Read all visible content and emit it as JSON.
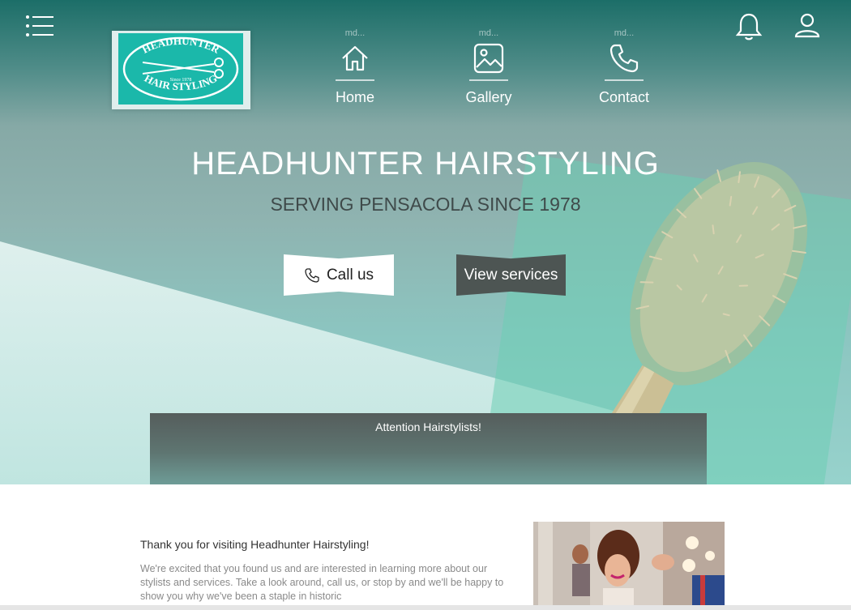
{
  "header": {
    "menu_icon": "list-menu-icon",
    "bell_icon": "bell-icon",
    "user_icon": "user-icon"
  },
  "logo": {
    "top_text": "HEADHUNTER",
    "bottom_text": "HAIR STYLING",
    "since_text": "Since 1978",
    "bg_color": "#1bb8aa"
  },
  "nav": {
    "items": [
      {
        "small": "md...",
        "label": "Home",
        "icon": "home-icon"
      },
      {
        "small": "md...",
        "label": "Gallery",
        "icon": "image-icon"
      },
      {
        "small": "md...",
        "label": "Contact",
        "icon": "phone-icon"
      }
    ]
  },
  "hero": {
    "title": "HEADHUNTER HAIRSTYLING",
    "subtitle": "SERVING PENSACOLA SINCE 1978",
    "call_label": "Call us",
    "services_label": "View services"
  },
  "attention": {
    "text": "Attention Hairstylists!"
  },
  "welcome": {
    "title": "Thank you for visiting Headhunter Hairstyling!",
    "body": "We're excited that you found us and are interested in learning more about our stylists and services. Take a look around, call us, or stop by and we'll be happy to show you why we've been a staple in historic"
  },
  "colors": {
    "teal_dark": "#1c6e68",
    "teal_light": "#8cc6c1",
    "button_dark": "#4d5553",
    "logo_teal": "#1bb8aa"
  }
}
